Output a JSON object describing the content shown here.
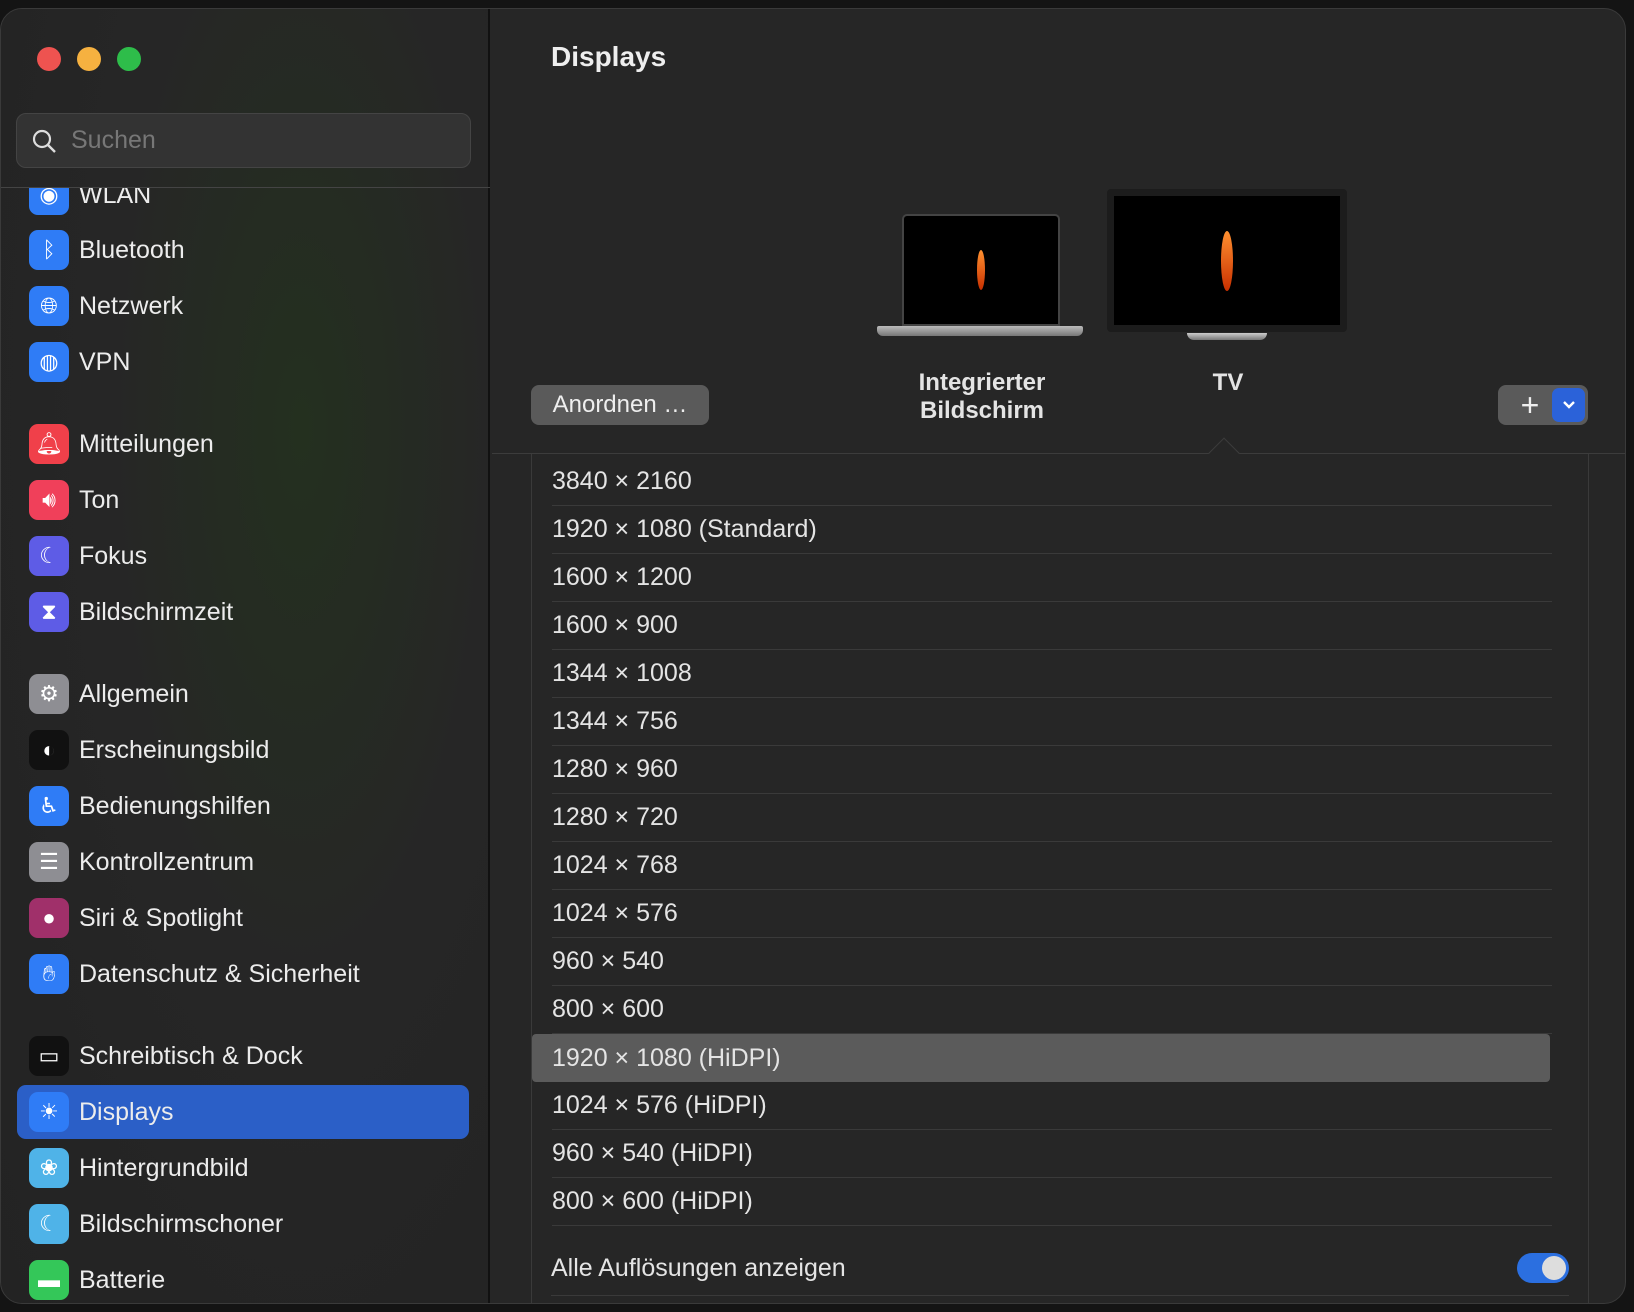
{
  "window": {
    "controls": [
      "close",
      "minimize",
      "zoom"
    ]
  },
  "search": {
    "placeholder": "Suchen"
  },
  "sidebar": {
    "items": [
      {
        "label": "WLAN",
        "icon": "wifi-icon",
        "color": "#2f7cf6"
      },
      {
        "label": "Bluetooth",
        "icon": "bluetooth-icon",
        "color": "#2f7cf6"
      },
      {
        "label": "Netzwerk",
        "icon": "globe-icon",
        "color": "#2f7cf6"
      },
      {
        "label": "VPN",
        "icon": "vpn-globe-icon",
        "color": "#2f7cf6"
      },
      {
        "label": "Mitteilungen",
        "icon": "bell-icon",
        "color": "#f0404a"
      },
      {
        "label": "Ton",
        "icon": "speaker-icon",
        "color": "#f0405a"
      },
      {
        "label": "Fokus",
        "icon": "moon-icon",
        "color": "#5e5ce6"
      },
      {
        "label": "Bildschirmzeit",
        "icon": "hourglass-icon",
        "color": "#5e5ce6"
      },
      {
        "label": "Allgemein",
        "icon": "gear-icon",
        "color": "#8e8e93"
      },
      {
        "label": "Erscheinungsbild",
        "icon": "appearance-icon",
        "color": "#111111"
      },
      {
        "label": "Bedienungshilfen",
        "icon": "accessibility-icon",
        "color": "#2f7cf6"
      },
      {
        "label": "Kontrollzentrum",
        "icon": "toggles-icon",
        "color": "#8e8e93"
      },
      {
        "label": "Siri & Spotlight",
        "icon": "siri-icon",
        "color": "#a0306a"
      },
      {
        "label": "Datenschutz & Sicherheit",
        "icon": "hand-icon",
        "color": "#2f7cf6"
      },
      {
        "label": "Schreibtisch & Dock",
        "icon": "dock-icon",
        "color": "#111111"
      },
      {
        "label": "Displays",
        "icon": "sun-icon",
        "color": "#2f7cf6",
        "selected": true
      },
      {
        "label": "Hintergrundbild",
        "icon": "flower-icon",
        "color": "#4fb3e8"
      },
      {
        "label": "Bildschirmschoner",
        "icon": "screensaver-icon",
        "color": "#4fb3e8"
      },
      {
        "label": "Batterie",
        "icon": "battery-icon",
        "color": "#34c759"
      }
    ]
  },
  "main": {
    "title": "Displays",
    "arrange_label": "Anordnen …",
    "add_label": "+",
    "displays": [
      {
        "label": "Integrierter Bildschirm"
      },
      {
        "label": "TV",
        "selected": true
      }
    ],
    "resolutions": [
      "3840 × 2160",
      "1920 × 1080 (Standard)",
      "1600 × 1200",
      "1600 × 900",
      "1344 × 1008",
      "1344 × 756",
      "1280 × 960",
      "1280 × 720",
      "1024 × 768",
      "1024 × 576",
      "960 × 540",
      "800 × 600",
      "1920 × 1080 (HiDPI)",
      "1024 × 576 (HiDPI)",
      "960 × 540 (HiDPI)",
      "800 × 600 (HiDPI)"
    ],
    "selected_resolution": "1920 × 1080 (HiDPI)",
    "show_all_label": "Alle Auflösungen anzeigen",
    "show_all_on": true,
    "accent": "#2b5fc7"
  }
}
